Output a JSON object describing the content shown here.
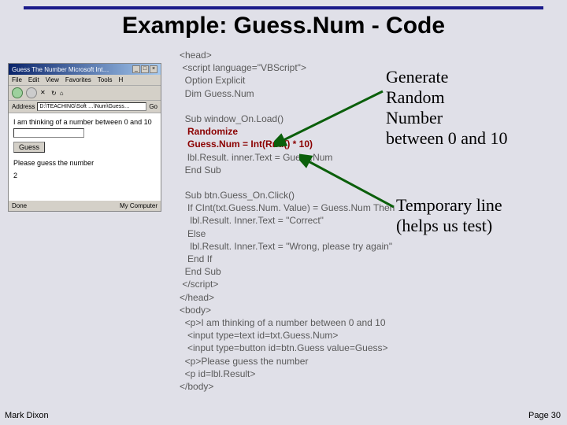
{
  "title": "Example: Guess.Num - Code",
  "browser": {
    "titlebar": "Guess The Number   Microsoft Int…",
    "menus": [
      "File",
      "Edit",
      "View",
      "Favorites",
      "Tools",
      "H"
    ],
    "address_label": "Address",
    "address_value": "D:\\TEACHING\\Soft …\\Num\\Guess…",
    "go": "Go",
    "line1": "I am thinking of a number between 0 and 10",
    "guess_btn": "Guess",
    "line2": "Please guess the number",
    "result": "2",
    "status_done": "Done",
    "status_zone": "My Computer"
  },
  "code": {
    "l1": "<head>",
    "l2": " <script language=\"VBScript\">",
    "l3": "  Option Explicit",
    "l4": "  Dim Guess.Num",
    "l5": "",
    "l6": "  Sub window_On.Load()",
    "l7b": "   Randomize",
    "l8b": "   Guess.Num = Int(Rnd() * 10)",
    "l9": "   lbl.Result. inner.Text = Guess.Num",
    "l10": "  End Sub",
    "l11": "",
    "l12": "  Sub btn.Guess_On.Click()",
    "l13": "   If CInt(txt.Guess.Num. Value) = Guess.Num Then",
    "l14": "    lbl.Result. Inner.Text = \"Correct\"",
    "l15": "   Else",
    "l16": "    lbl.Result. Inner.Text = \"Wrong, please try again\"",
    "l17": "   End If",
    "l18": "  End Sub",
    "l19": " </script>",
    "l20": "</head>",
    "l21": "<body>",
    "l22": "  <p>I am thinking of a number between 0 and 10",
    "l23": "   <input type=text id=txt.Guess.Num>",
    "l24": "   <input type=button id=btn.Guess value=Guess>",
    "l25": "  <p>Please guess the number",
    "l26": "  <p id=lbl.Result>",
    "l27": "</body>"
  },
  "annotation1": {
    "l1": "Generate",
    "l2": "Random",
    "l3": "Number",
    "l4": "between 0 and 10"
  },
  "annotation2": {
    "l1": "Temporary line",
    "l2": "(helps us test)"
  },
  "footer": {
    "left": "Mark Dixon",
    "right": "Page 30"
  }
}
